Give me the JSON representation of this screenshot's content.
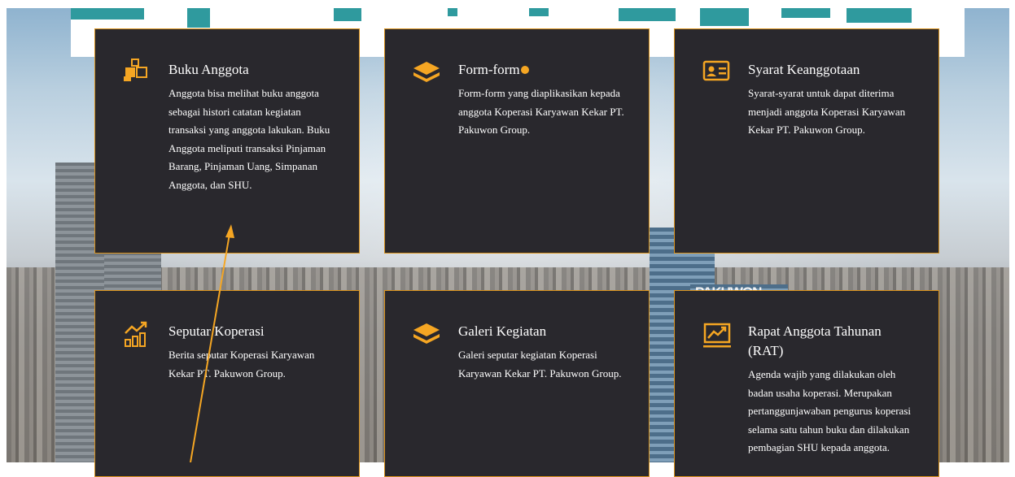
{
  "colors": {
    "accent": "#f5a623",
    "card_bg": "#29282d",
    "border": "#d8911b"
  },
  "background": {
    "sign_text": "PAKUWON"
  },
  "cards": [
    {
      "icon": "cubes-icon",
      "title": "Buku Anggota",
      "desc": "Anggota bisa melihat buku anggota sebagai histori catatan kegiatan transaksi yang anggota lakukan. Buku Anggota meliputi transaksi Pinjaman Barang, Pinjaman Uang, Simpanan Anggota, dan SHU."
    },
    {
      "icon": "layers-icon",
      "title": "Form-form",
      "desc": "Form-form yang diaplikasikan kepada anggota Koperasi Karyawan Kekar PT. Pakuwon Group."
    },
    {
      "icon": "id-card-icon",
      "title": "Syarat Keanggotaan",
      "desc": "Syarat-syarat untuk dapat diterima menjadi anggota Koperasi Karyawan Kekar PT. Pakuwon Group."
    },
    {
      "icon": "chart-growth-icon",
      "title": "Seputar Koperasi",
      "desc": "Berita seputar Koperasi Karyawan Kekar PT. Pakuwon Group."
    },
    {
      "icon": "layers-icon",
      "title": "Galeri Kegiatan",
      "desc": "Galeri seputar kegiatan Koperasi Karyawan Kekar PT. Pakuwon Group."
    },
    {
      "icon": "trend-chart-icon",
      "title": "Rapat Anggota Tahunan (RAT)",
      "desc": "Agenda wajib yang dilakukan oleh badan usaha koperasi. Merupakan pertanggunjawaban pengurus koperasi selama satu tahun buku dan dilakukan pembagian SHU kepada anggota."
    }
  ]
}
